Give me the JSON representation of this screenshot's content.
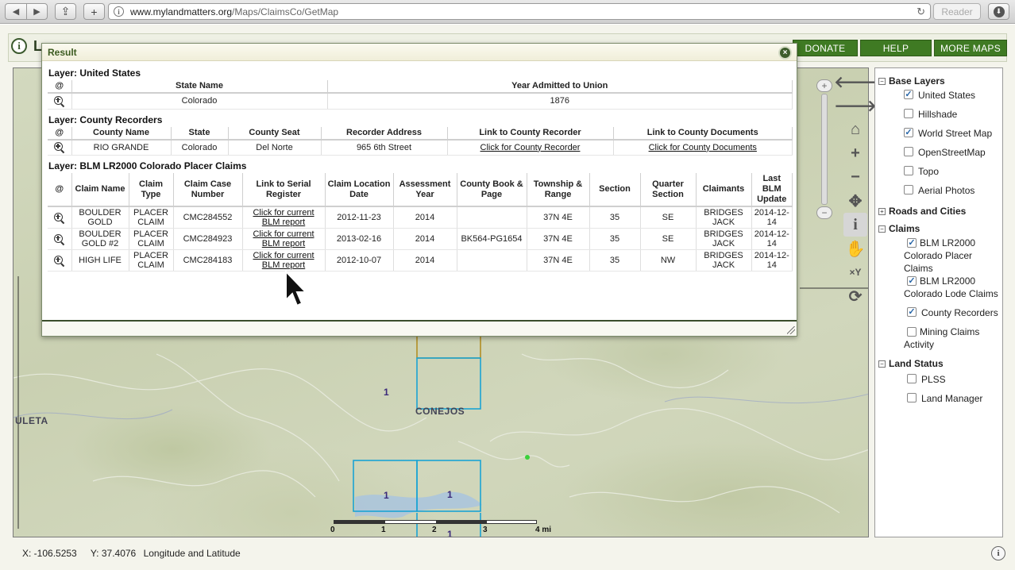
{
  "browser": {
    "url_domain": "www.mylandmatters.org",
    "url_path": "/Maps/ClaimsCo/GetMap",
    "reader_label": "Reader"
  },
  "header": {
    "title_fragment": "L",
    "links": [
      "DONATE",
      "HELP",
      "MORE MAPS"
    ]
  },
  "dialog": {
    "title": "Result",
    "layers": [
      {
        "title": "Layer: United States",
        "headers": [
          "@",
          "State Name",
          "Year Admitted to Union"
        ],
        "rows": [
          [
            "Colorado",
            "1876"
          ]
        ]
      },
      {
        "title": "Layer: County Recorders",
        "headers": [
          "@",
          "County Name",
          "State",
          "County Seat",
          "Recorder Address",
          "Link to County Recorder",
          "Link to County Documents"
        ],
        "rows": [
          [
            "RIO GRANDE",
            "Colorado",
            "Del Norte",
            "965 6th Street",
            "Click for County Recorder",
            "Click for County Documents"
          ]
        ]
      },
      {
        "title": "Layer: BLM LR2000 Colorado Placer Claims",
        "headers": [
          "@",
          "Claim Name",
          "Claim Type",
          "Claim Case Number",
          "Link to Serial Register",
          "Claim Location Date",
          "Assessment Year",
          "County Book & Page",
          "Township & Range",
          "Section",
          "Quarter Section",
          "Claimants",
          "Last BLM Update"
        ],
        "rows": [
          [
            "BOULDER GOLD",
            "PLACER CLAIM",
            "CMC284552",
            "Click for current BLM report",
            "2012-11-23",
            "2014",
            "",
            "37N 4E",
            "35",
            "SE",
            "BRIDGES JACK",
            "2014-12-14"
          ],
          [
            "BOULDER GOLD #2",
            "PLACER CLAIM",
            "CMC284923",
            "Click for current BLM report",
            "2013-02-16",
            "2014",
            "BK564-PG1654",
            "37N 4E",
            "35",
            "SE",
            "BRIDGES JACK",
            "2014-12-14"
          ],
          [
            "HIGH LIFE",
            "PLACER CLAIM",
            "CMC284183",
            "Click for current BLM report",
            "2012-10-07",
            "2014",
            "",
            "37N 4E",
            "35",
            "NW",
            "BRIDGES JACK",
            "2014-12-14"
          ]
        ]
      }
    ]
  },
  "map": {
    "labels": [
      "CONEJOS",
      "ULETA"
    ],
    "claim_numbers": [
      "1",
      "1",
      "1",
      "1"
    ],
    "scale_labels": [
      "0",
      "1",
      "2",
      "3",
      "4 mi"
    ]
  },
  "layers_panel": {
    "groups": [
      {
        "name": "Base Layers",
        "items": [
          {
            "label": "United States",
            "checked": true
          },
          {
            "label": "Hillshade",
            "checked": false
          },
          {
            "label": "World Street Map",
            "checked": true
          },
          {
            "label": "OpenStreetMap",
            "checked": false
          },
          {
            "label": "Topo",
            "checked": false
          },
          {
            "label": "Aerial Photos",
            "checked": false
          }
        ]
      },
      {
        "name": "Roads and Cities",
        "collapsed": true,
        "items": []
      },
      {
        "name": "Claims",
        "items": [
          {
            "label": "BLM LR2000 Colorado Placer Claims",
            "checked": true
          },
          {
            "label": "BLM LR2000 Colorado Lode Claims",
            "checked": true
          },
          {
            "label": "County Recorders",
            "checked": true
          },
          {
            "label": "Mining Claims Activity",
            "checked": false
          }
        ]
      },
      {
        "name": "Land Status",
        "items": [
          {
            "label": "PLSS",
            "checked": false
          },
          {
            "label": "Land Manager",
            "checked": false
          }
        ]
      }
    ]
  },
  "status": {
    "x": "X: -106.5253",
    "y": "Y: 37.4076",
    "units": "Longitude and Latitude"
  },
  "icons": [
    "back-arrow-icon",
    "forward-arrow-icon",
    "share-icon",
    "add-tab-icon",
    "reload-icon",
    "download-icon",
    "info-icon",
    "close-icon",
    "zoom-to-icon",
    "home-icon",
    "zoom-in-icon",
    "zoom-out-icon",
    "pan-icon",
    "identify-icon",
    "hand-icon",
    "xy-icon",
    "refresh-icon"
  ],
  "colors": {
    "nav_green": "#3f7a23",
    "dialog_title": "#3b5a1f",
    "claim_outline": "#1aa3d4",
    "claim_outline_selected": "#b08a1a"
  }
}
